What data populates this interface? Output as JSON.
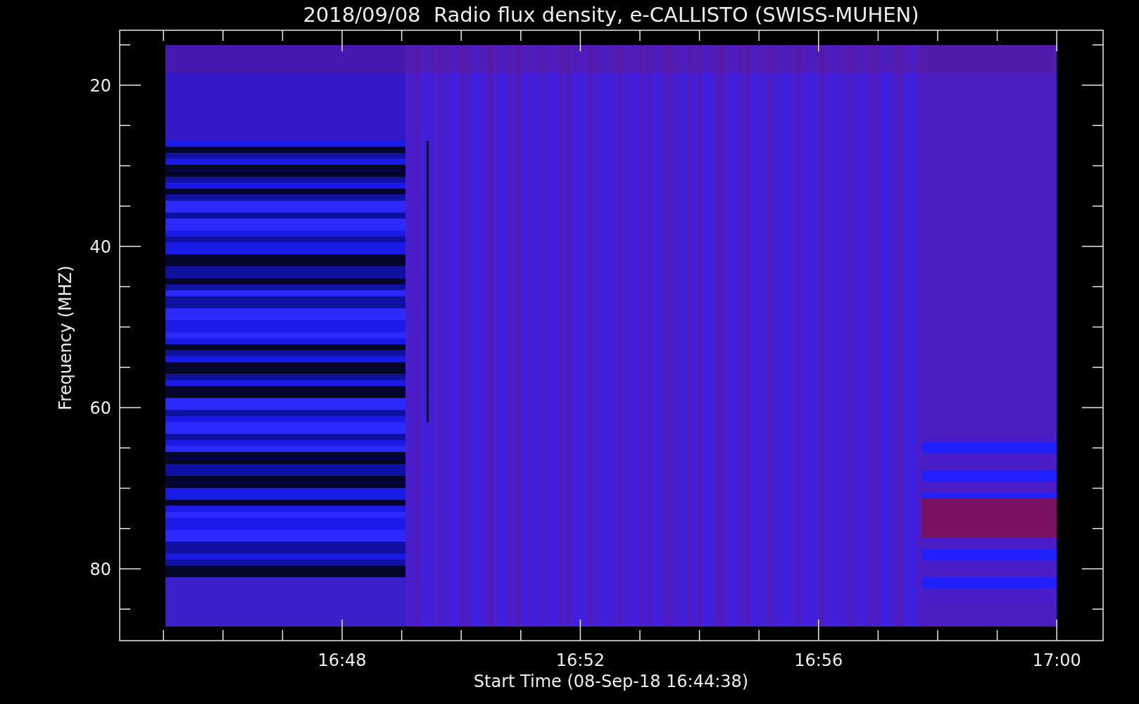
{
  "title": "2018/09/08  Radio flux density, e-CALLISTO (SWISS-MUHEN)",
  "y_axis": {
    "label": "Frequency (MHZ)",
    "ticks": [
      "20",
      "40",
      "60",
      "80"
    ]
  },
  "x_axis": {
    "label": "Start Time (08-Sep-18 16:44:38)",
    "ticks": [
      "16:48",
      "16:52",
      "16:56",
      "17:00"
    ]
  }
}
